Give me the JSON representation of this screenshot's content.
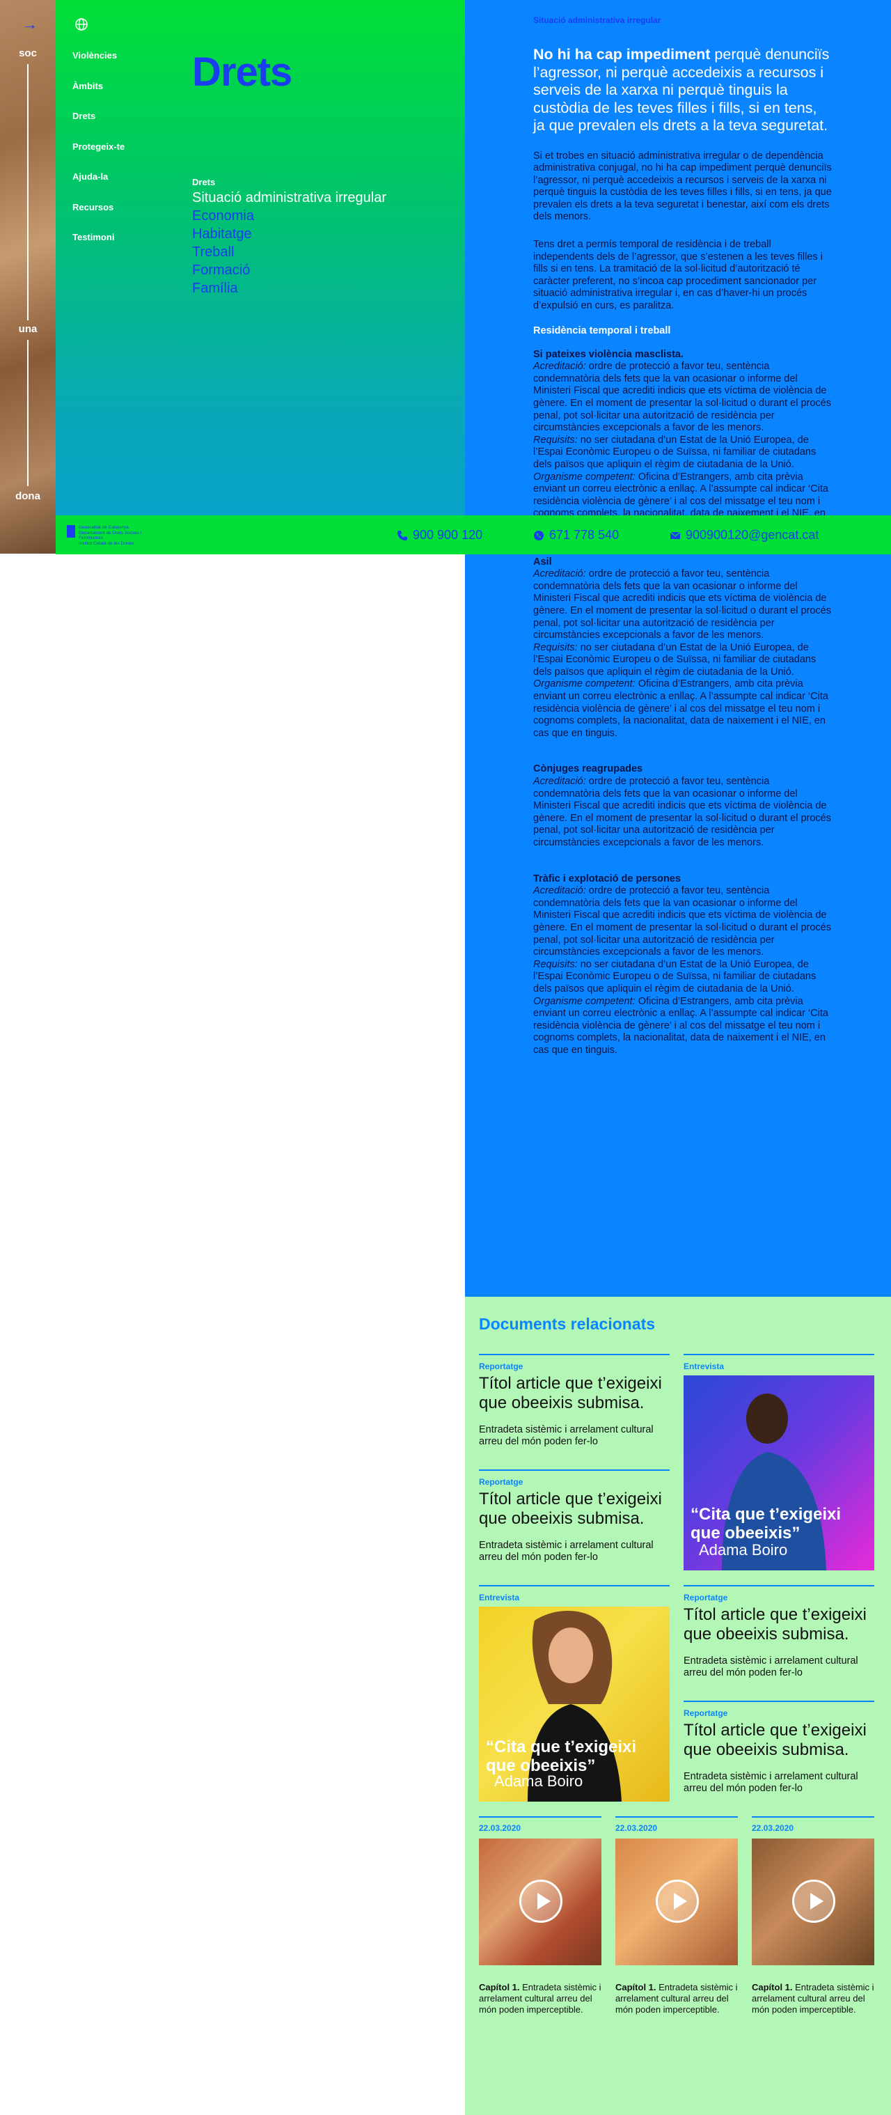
{
  "rail": {
    "words": [
      "soc",
      "una",
      "dona"
    ]
  },
  "nav": {
    "items": [
      "Violències",
      "Àmbits",
      "Drets",
      "Protegeix-te",
      "Ajuda-la",
      "Recursos",
      "Testimoni"
    ],
    "title": "Drets",
    "subnav_head": "Drets",
    "subnav": [
      "Situació administrativa irregular",
      "Economia",
      "Habitatge",
      "Treball",
      "Formació",
      "Família"
    ]
  },
  "content": {
    "breadcrumb": "Situació administrativa irregular",
    "lead_bold": "No hi ha cap impediment",
    "lead_rest": " perquè denunciïs l’agressor, ni perquè accedeixis a recursos i serveis de la xarxa ni perquè tinguis la custòdia de les teves filles i fills, si en tens, ja que prevalen els drets a la teva seguretat.",
    "para1": "Si et trobes en situació administrativa irregular o de dependència administrativa conjugal, no hi ha cap impediment perquè denunciïs l’agressor, ni perquè accedeixis a recursos i serveis de la xarxa ni perquè tinguis la custòdia de les teves filles i fills, si en tens, ja que prevalen els drets a la teva seguretat i benestar, així com els drets dels menors.",
    "para2": "Tens dret a permís temporal de residència i de treball independents dels de l’agressor, que s’estenen a les teves filles i fills si en tens. La tramitació de la sol·licitud d’autorització té caràcter preferent, no s’incoa cap procediment sancionador per situació administrativa irregular i, en cas d’haver-hi un procés d’expulsió en curs, es paralitza.",
    "section": "Residència temporal i treball",
    "blocks": [
      {
        "heading": "Si pateixes violència masclista.",
        "acr_label": "Acreditació:",
        "acr": " ordre de protecció a favor teu, sentència condemnatòria dels fets que la van ocasionar o informe del Ministeri Fiscal que acrediti indicis que ets víctima de violència de gènere. En el moment de presentar la sol·licitud o durant el procés penal, pot sol·licitar una autorització de residència per circumstàncies excepcionals a favor de les menors.",
        "req_label": "Requisits:",
        "req": " no ser ciutadana d’un Estat de la Unió Europea, de l’Espai Econòmic Europeu o de Suïssa, ni familiar de ciutadans dels països que apliquin el règim de ciutadania de la Unió.",
        "org_label": "Organisme competent:",
        "org": " Oficina d’Estrangers, amb cita prèvia enviant un correu electrònic a enllaç. A l’assumpte cal indicar ‘Cita residència violència de gènere’ i al cos del missatge el teu nom i cognoms complets, la nacionalitat, data de naixement i el NIE, en cas que en tinguis."
      },
      {
        "heading": "Asil",
        "acr_label": "Acreditació:",
        "acr": " ordre de protecció a favor teu, sentència condemnatòria dels fets que la van ocasionar o informe del Ministeri Fiscal que acrediti indicis que ets víctima de violència de gènere. En el moment de presentar la sol·licitud o durant el procés penal, pot sol·licitar una autorització de residència per circumstàncies excepcionals a favor de les menors.",
        "req_label": "Requisits:",
        "req": " no ser ciutadana d’un Estat de la Unió Europea, de l’Espai Econòmic Europeu o de Suïssa, ni familiar de ciutadans dels països que apliquin el règim de ciutadania de la Unió.",
        "org_label": "Organisme competent:",
        "org": " Oficina d’Estrangers, amb cita prèvia enviant un correu electrònic a enllaç. A l’assumpte cal indicar ‘Cita residència violència de gènere’ i al cos del missatge el teu nom i cognoms complets, la nacionalitat, data de naixement i el NIE, en cas que en tinguis."
      },
      {
        "heading": "Cònjuges reagrupades",
        "acr_label": "Acreditació:",
        "acr": " ordre de protecció a favor teu, sentència condemnatòria dels fets que la van ocasionar o informe del Ministeri Fiscal que acrediti indicis que ets víctima de violència de gènere. En el moment de presentar la sol·licitud o durant el procés penal, pot sol·licitar una autorització de residència per circumstàncies excepcionals a favor de les menors."
      },
      {
        "heading": "Tràfic i explotació de persones",
        "acr_label": "Acreditació:",
        "acr": " ordre de protecció a favor teu, sentència condemnatòria dels fets que la van ocasionar o informe del Ministeri Fiscal que acrediti indicis que ets víctima de violència de gènere. En el moment de presentar la sol·licitud o durant el procés penal, pot sol·licitar una autorització de residència per circumstàncies excepcionals a favor de les menors.",
        "req_label": "Requisits:",
        "req": " no ser ciutadana d’un Estat de la Unió Europea, de l’Espai Econòmic Europeu o de Suïssa, ni familiar de ciutadans dels països que apliquin el règim de ciutadania de la Unió.",
        "org_label": "Organisme competent:",
        "org": " Oficina d’Estrangers, amb cita prèvia enviant un correu electrònic a enllaç. A l’assumpte cal indicar ‘Cita residència violència de gènere’ i al cos del missatge el teu nom i cognoms complets, la nacionalitat, data de naixement i el NIE, en cas que en tinguis."
      }
    ]
  },
  "bar": {
    "logo_line1": "Generalitat de Catalunya",
    "logo_line2": "Departament de Drets Socials i Feminismes",
    "logo_line3": "Institut Català de les Dones",
    "phone1": "900 900 120",
    "phone2": "671 778 540",
    "email": "900900120@gencat.cat"
  },
  "docs": {
    "title": "Documents relacionats",
    "article_tag": "Reportatge",
    "article_title": "Títol article que t’exigeixi que obeeixis submisa.",
    "article_desc": "Entradeta sistèmic i arrelament cultural arreu del món poden fer-lo",
    "interview_tag": "Entrevista",
    "interview_quote": "“Cita que t’exigeixi que obeeixis”",
    "interview_by": "Adama Boiro",
    "video_date": "22.03.2020",
    "video_cap_bold": "Capítol 1.",
    "video_cap": " Entradeta sistèmic i arrelament cultural arreu del món poden imperceptible."
  },
  "colors": {
    "accent_blue": "#0a84ff",
    "brand_green": "#00e036",
    "title_blue": "#1b3df0",
    "docs_bg": "#b3f7b7"
  }
}
